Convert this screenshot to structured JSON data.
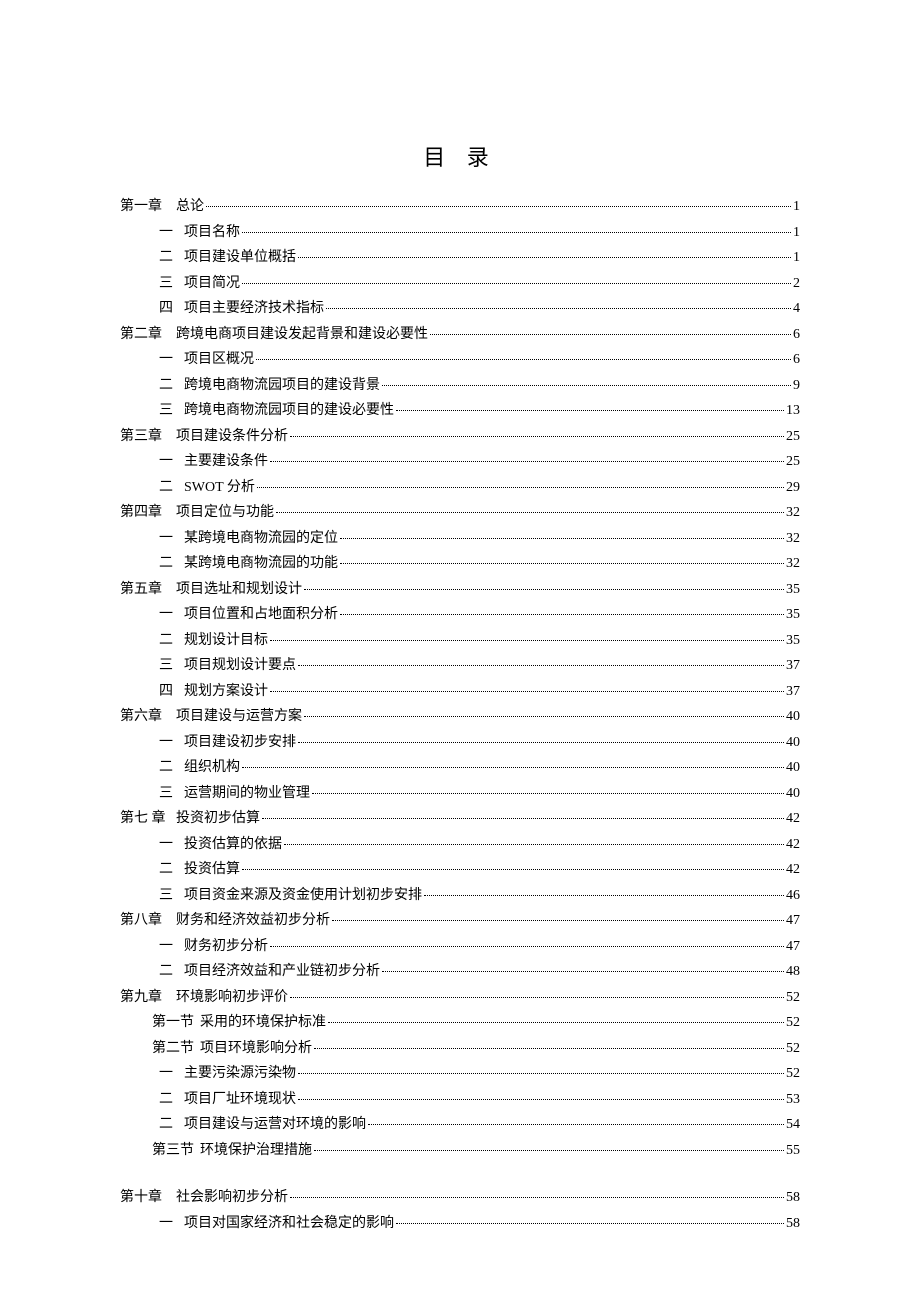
{
  "title": "目 录",
  "entries": [
    {
      "level": "chapter",
      "label": "第一章",
      "labelSuffix": "总论",
      "text": "",
      "page": "1"
    },
    {
      "level": "sub",
      "label": "一",
      "text": "项目名称",
      "page": "1"
    },
    {
      "level": "sub",
      "label": "二",
      "text": "项目建设单位概括",
      "page": "1"
    },
    {
      "level": "sub",
      "label": "三",
      "text": "项目简况",
      "page": "2"
    },
    {
      "level": "sub",
      "label": "四",
      "text": "项目主要经济技术指标",
      "page": "4"
    },
    {
      "level": "chapter",
      "label": "第二章",
      "text": "跨境电商项目建设发起背景和建设必要性",
      "page": "6"
    },
    {
      "level": "sub",
      "label": "一",
      "text": "项目区概况",
      "page": "6"
    },
    {
      "level": "sub",
      "label": "二",
      "text": "跨境电商物流园项目的建设背景",
      "page": "9"
    },
    {
      "level": "sub",
      "label": "三",
      "text": "跨境电商物流园项目的建设必要性",
      "page": "13"
    },
    {
      "level": "chapter",
      "label": "第三章",
      "text": "项目建设条件分析",
      "page": "25"
    },
    {
      "level": "sub",
      "label": "一",
      "text": "主要建设条件",
      "page": "25"
    },
    {
      "level": "sub",
      "label": "二",
      "text": "SWOT 分析",
      "page": "29"
    },
    {
      "level": "chapter",
      "label": "第四章",
      "text": "项目定位与功能",
      "page": "32"
    },
    {
      "level": "sub",
      "label": "一",
      "text": "某跨境电商物流园的定位",
      "page": "32"
    },
    {
      "level": "sub",
      "label": "二",
      "text": "某跨境电商物流园的功能",
      "page": "32"
    },
    {
      "level": "chapter",
      "label": "第五章",
      "text": "项目选址和规划设计",
      "page": "35"
    },
    {
      "level": "sub",
      "label": "一",
      "text": "项目位置和占地面积分析",
      "page": "35"
    },
    {
      "level": "sub",
      "label": "二",
      "text": "规划设计目标",
      "page": "35"
    },
    {
      "level": "sub",
      "label": "三",
      "text": "项目规划设计要点",
      "page": "37"
    },
    {
      "level": "sub",
      "label": "四",
      "text": "规划方案设计",
      "page": "37"
    },
    {
      "level": "chapter",
      "label": "第六章",
      "text": "项目建设与运营方案",
      "page": "40"
    },
    {
      "level": "sub",
      "label": "一",
      "text": "项目建设初步安排",
      "page": "40"
    },
    {
      "level": "sub",
      "label": "二",
      "text": "组织机构",
      "page": "40"
    },
    {
      "level": "sub",
      "label": "三",
      "text": "运营期间的物业管理",
      "page": "40"
    },
    {
      "level": "chapter",
      "label": "第七 章",
      "text": "投资初步估算",
      "page": "42"
    },
    {
      "level": "sub",
      "label": "一",
      "text": "投资估算的依据",
      "page": "42"
    },
    {
      "level": "sub",
      "label": "二",
      "text": "投资估算",
      "page": "42"
    },
    {
      "level": "sub",
      "label": "三",
      "text": "项目资金来源及资金使用计划初步安排",
      "page": "46"
    },
    {
      "level": "chapter",
      "label": "第八章",
      "text": "财务和经济效益初步分析",
      "page": "47"
    },
    {
      "level": "sub",
      "label": "一",
      "text": "财务初步分析",
      "page": "47"
    },
    {
      "level": "sub",
      "label": "二",
      "text": "项目经济效益和产业链初步分析",
      "page": "48"
    },
    {
      "level": "chapter",
      "label": "第九章",
      "text": "环境影响初步评价",
      "page": "52"
    },
    {
      "level": "section",
      "label": "第一节",
      "text": "采用的环境保护标准",
      "page": "52"
    },
    {
      "level": "section",
      "label": "第二节",
      "text": "项目环境影响分析",
      "page": "52"
    },
    {
      "level": "sub",
      "label": "一",
      "text": "主要污染源污染物",
      "page": "52"
    },
    {
      "level": "sub",
      "label": "二",
      "text": "项目厂址环境现状",
      "page": "53"
    },
    {
      "level": "sub",
      "label": "二",
      "text": "项目建设与运营对环境的影响",
      "page": "54"
    },
    {
      "level": "section",
      "label": "第三节",
      "text": "环境保护治理措施",
      "page": "55"
    },
    {
      "level": "gap"
    },
    {
      "level": "chapter",
      "label": "第十章",
      "text": "社会影响初步分析",
      "page": "58"
    },
    {
      "level": "sub",
      "label": "一",
      "text": "项目对国家经济和社会稳定的影响",
      "page": "58"
    }
  ]
}
